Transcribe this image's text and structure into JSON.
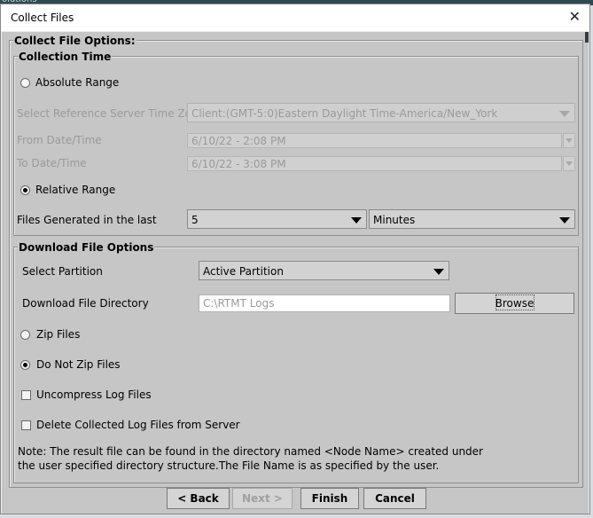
{
  "background_window_text": "olutions",
  "window": {
    "title": "Collect Files",
    "close_glyph": "✕"
  },
  "collect_file_options": {
    "legend": "Collect File Options:"
  },
  "collection_time": {
    "legend": "Collection Time",
    "absolute_range_label": "Absolute Range",
    "absolute_range_selected": false,
    "timezone_label": "Select Reference Server Time Zo...",
    "timezone_value": "Client:(GMT-5:0)Eastern Daylight Time-America/New_York",
    "from_label": "From Date/Time",
    "from_value": "6/10/22 - 2:08 PM",
    "to_label": "To Date/Time",
    "to_value": "6/10/22 - 3:08 PM",
    "relative_range_label": "Relative Range",
    "relative_range_selected": true,
    "files_generated_label": "Files Generated in the last",
    "files_generated_count": "5",
    "files_generated_unit": "Minutes"
  },
  "download_file_options": {
    "legend": "Download File Options",
    "partition_label": "Select Partition",
    "partition_value": "Active Partition",
    "directory_label": "Download File Directory",
    "directory_value": "C:\\RTMT Logs",
    "browse_label": "Browse",
    "zip_files_label": "Zip Files",
    "zip_files_selected": false,
    "do_not_zip_label": "Do Not Zip Files",
    "do_not_zip_selected": true,
    "uncompress_label": "Uncompress Log Files",
    "uncompress_checked": false,
    "delete_label": "Delete Collected Log Files from Server",
    "delete_checked": false,
    "note_line1": "Note: The result file can be found in the directory named <Node Name> created under",
    "note_line2": "the user specified directory structure.The File Name is as specified by the user."
  },
  "footer": {
    "back_label": "< Back",
    "next_label": "Next >",
    "finish_label": "Finish",
    "cancel_label": "Cancel"
  },
  "icons": [
    "close-icon",
    "dropdown-arrow-icon",
    "radio-icon",
    "checkbox-icon",
    "spinner-arrow-icon"
  ]
}
